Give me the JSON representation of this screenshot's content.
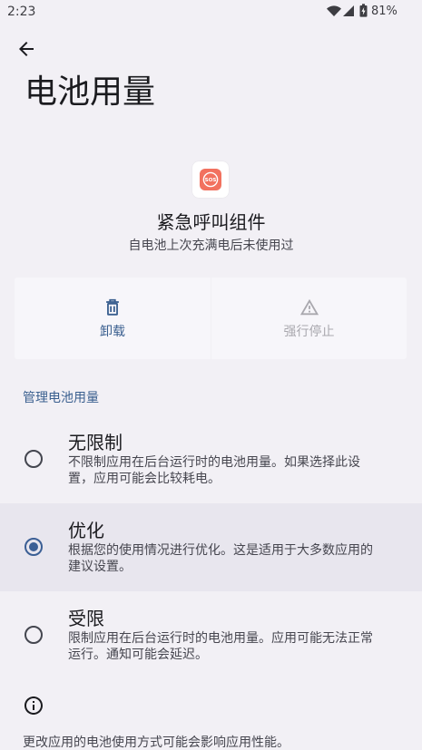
{
  "status_bar": {
    "time": "2:23",
    "battery_percent": "81%",
    "icons": [
      "wifi-icon",
      "cell-signal-icon",
      "battery-charging-icon"
    ]
  },
  "header": {
    "back_icon": "arrow-back-icon",
    "title": "电池用量"
  },
  "app": {
    "icon": "sos-app-icon",
    "icon_text": "SOS",
    "name": "紧急呼叫组件",
    "summary": "自电池上次充满电后未使用过"
  },
  "actions": [
    {
      "label": "卸载",
      "icon": "trash-icon",
      "disabled": false
    },
    {
      "label": "强行停止",
      "icon": "warning-icon",
      "disabled": true
    }
  ],
  "section": {
    "title": "管理电池用量"
  },
  "options": [
    {
      "title": "无限制",
      "description": "不限制应用在后台运行时的电池用量。如果选择此设置，应用可能会比较耗电。",
      "selected": false
    },
    {
      "title": "优化",
      "description": "根据您的使用情况进行优化。这是适用于大多数应用的建议设置。",
      "selected": true
    },
    {
      "title": "受限",
      "description": "限制应用在后台运行时的电池用量。应用可能无法正常运行。通知可能会延迟。",
      "selected": false
    }
  ],
  "footer": {
    "icon": "info-icon",
    "text": "更改应用的电池使用方式可能会影响应用性能。"
  },
  "colors": {
    "bg": "#f2f0f5",
    "card": "#f7f6fa",
    "selected_row": "#e8e6ee",
    "accent": "#3a5f8f",
    "accent_radio": "#3b5f95",
    "text": "#1b1b1f",
    "text_secondary": "#46464f",
    "disabled": "#a9a8ae",
    "radio_off": "#44464f",
    "sos": "#f2715f"
  }
}
